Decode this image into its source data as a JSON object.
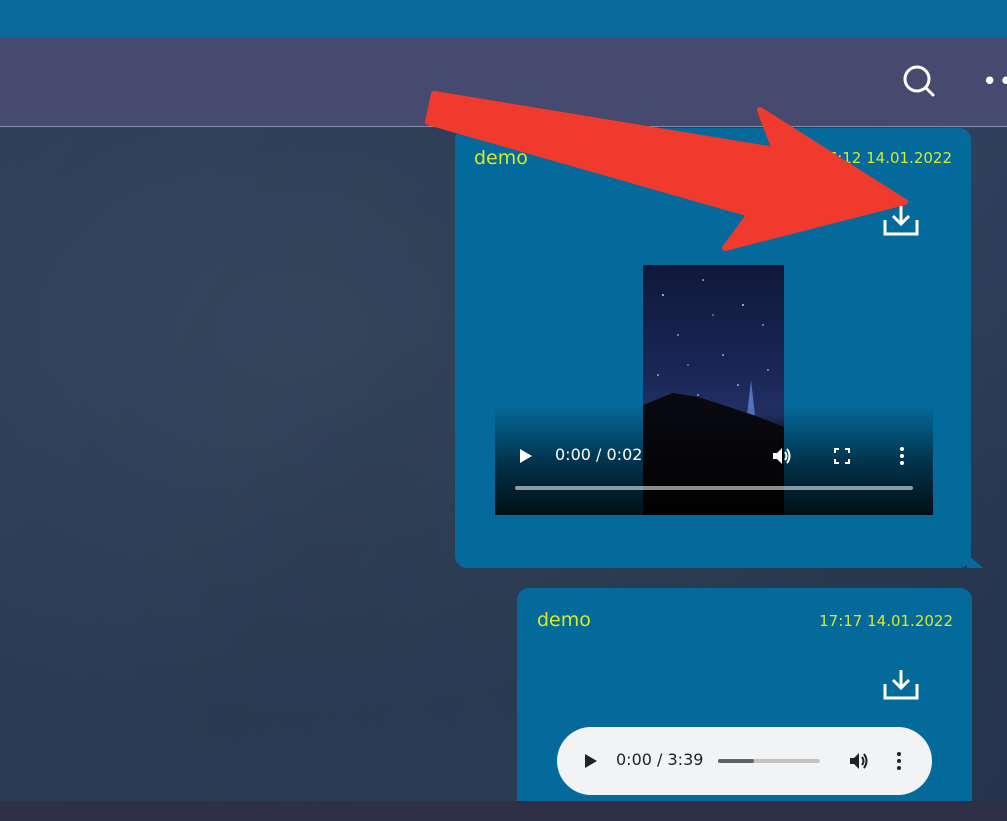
{
  "header": {
    "search_icon": "search-icon",
    "more_icon": "more-icon",
    "more_label": "•••"
  },
  "messages": [
    {
      "sender": "demo",
      "timestamp": "17:12 14.01.2022",
      "attachment": "video",
      "player": {
        "time": "0:00 / 0:02",
        "progress": 0.0
      }
    },
    {
      "sender": "demo",
      "timestamp": "17:17 14.01.2022",
      "attachment": "audio",
      "player": {
        "time": "0:00 / 3:39",
        "buffered": 0.35
      }
    }
  ],
  "annotation": {
    "color": "#f03a2e",
    "points_to": "download-icon"
  },
  "colors": {
    "accent_text": "#d6ea2a",
    "bubble": "#046a9c",
    "header": "#464a6e",
    "topbar": "#0a6a9c"
  }
}
